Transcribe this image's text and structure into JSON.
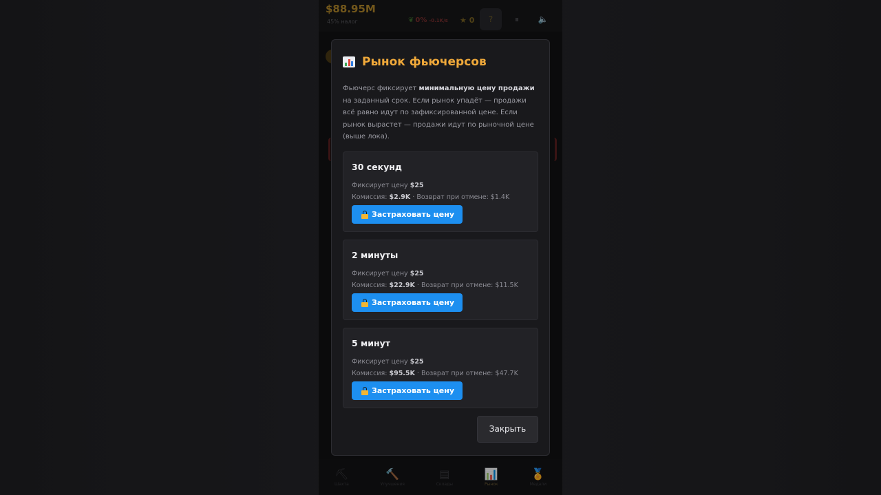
{
  "app": {
    "balance": "$88.95M",
    "rate": "45% налог",
    "trend_percent": "0%",
    "trend_delta": "-0.1K/s",
    "stars": "★ 0",
    "help_label": "?",
    "pause_label": "⏸",
    "sound_label": "🔈"
  },
  "nav": [
    {
      "icon": "⛏",
      "label": "Шахта"
    },
    {
      "icon": "🔨",
      "label": "Улучшения"
    },
    {
      "icon": "▤",
      "label": "Склады"
    },
    {
      "icon": "📊",
      "label": "Рынок"
    },
    {
      "icon": "🏅",
      "label": "Медали"
    }
  ],
  "modal": {
    "icon": "bar-chart-icon",
    "title": "Рынок фьючерсов",
    "desc_pre": "Фьючерс фиксирует ",
    "desc_bold": "минимальную цену продажи",
    "desc_post": " на заданный срок. Если рынок упадёт — продажи всё равно идут по зафиксированной цене. Если рынок вырастет — продажи идут по рыночной цене (выше лока).",
    "plans": [
      {
        "name": "30 секунд",
        "fix_label": "Фиксирует цену ",
        "fix_value": "$25",
        "fee_label": "Комиссия: ",
        "fee_value": "$2.9K",
        "refund_text": " · Возврат при отмене: $1.4K",
        "button": "Застраховать цену"
      },
      {
        "name": "2 минуты",
        "fix_label": "Фиксирует цену ",
        "fix_value": "$25",
        "fee_label": "Комиссия: ",
        "fee_value": "$22.9K",
        "refund_text": " · Возврат при отмене: $11.5K",
        "button": "Застраховать цену"
      },
      {
        "name": "5 минут",
        "fix_label": "Фиксирует цену ",
        "fix_value": "$25",
        "fee_label": "Комиссия: ",
        "fee_value": "$95.5K",
        "refund_text": " · Возврат при отмене: $47.7K",
        "button": "Застраховать цену"
      }
    ],
    "close_label": "Закрыть"
  },
  "colors": {
    "accent": "#f0a93a",
    "button": "#1d8ff0",
    "modal_bg": "#19191c",
    "card_bg": "#222226"
  }
}
